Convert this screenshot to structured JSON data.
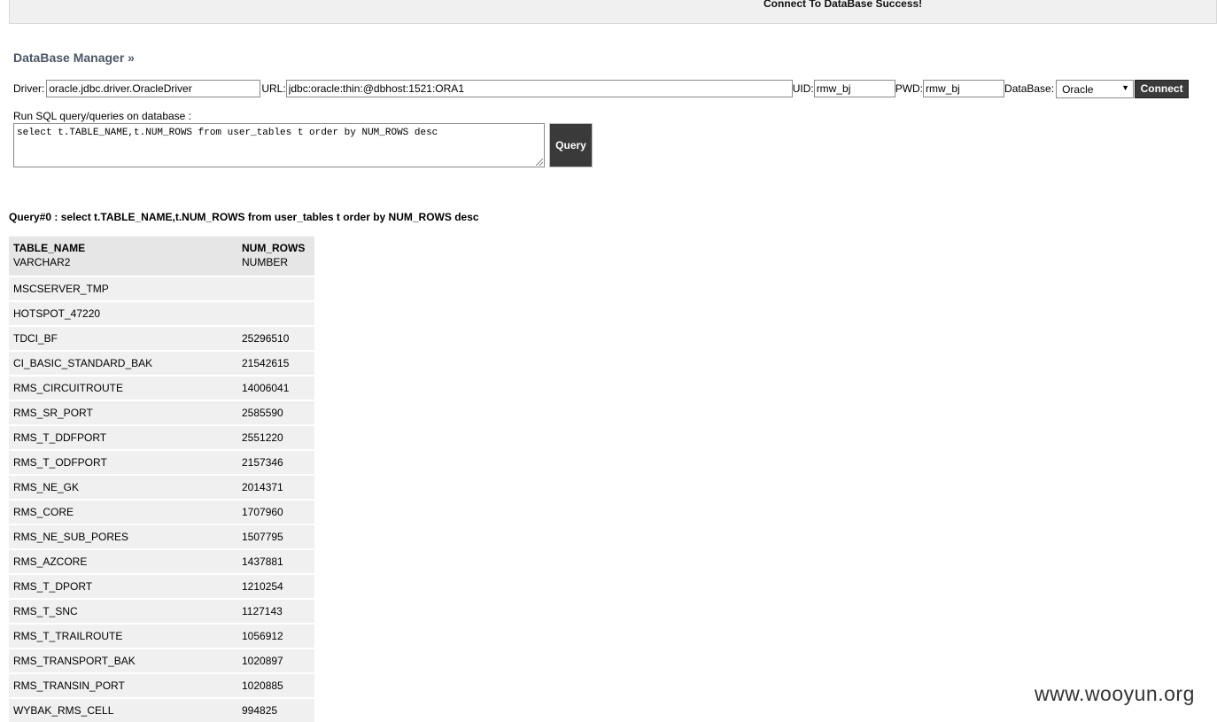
{
  "status_message": "Connect To DataBase Success!",
  "section_title": "DataBase Manager »",
  "connection": {
    "driver_label": "Driver:",
    "driver_value": "oracle.jdbc.driver.OracleDriver",
    "url_label": "URL:",
    "url_value": "jdbc:oracle:thin:@dbhost:1521:ORA1",
    "uid_label": "UID:",
    "uid_value": "rmw_bj",
    "pwd_label": "PWD:",
    "pwd_value": "rmw_bj",
    "database_label": "DataBase:",
    "database_value": "Oracle",
    "connect_button": "Connect"
  },
  "sql": {
    "label": "Run SQL query/queries on database :",
    "query_text": "select t.TABLE_NAME,t.NUM_ROWS from user_tables t order by NUM_ROWS desc",
    "query_button": "Query"
  },
  "result": {
    "heading": "Query#0 : select t.TABLE_NAME,t.NUM_ROWS from user_tables t order by NUM_ROWS desc",
    "columns": [
      {
        "name": "TABLE_NAME",
        "type": "VARCHAR2"
      },
      {
        "name": "NUM_ROWS",
        "type": "NUMBER"
      }
    ],
    "rows": [
      [
        "MSCSERVER_TMP",
        ""
      ],
      [
        "HOTSPOT_47220",
        ""
      ],
      [
        "TDCI_BF",
        "25296510"
      ],
      [
        "CI_BASIC_STANDARD_BAK",
        "21542615"
      ],
      [
        "RMS_CIRCUITROUTE",
        "14006041"
      ],
      [
        "RMS_SR_PORT",
        "2585590"
      ],
      [
        "RMS_T_DDFPORT",
        "2551220"
      ],
      [
        "RMS_T_ODFPORT",
        "2157346"
      ],
      [
        "RMS_NE_GK",
        "2014371"
      ],
      [
        "RMS_CORE",
        "1707960"
      ],
      [
        "RMS_NE_SUB_PORES",
        "1507795"
      ],
      [
        "RMS_AZCORE",
        "1437881"
      ],
      [
        "RMS_T_DPORT",
        "1210254"
      ],
      [
        "RMS_T_SNC",
        "1127143"
      ],
      [
        "RMS_T_TRAILROUTE",
        "1056912"
      ],
      [
        "RMS_TRANSPORT_BAK",
        "1020897"
      ],
      [
        "RMS_TRANSIN_PORT",
        "1020885"
      ],
      [
        "WYBAK_RMS_CELL",
        "994825"
      ]
    ]
  },
  "watermark": "www.wooyun.org"
}
